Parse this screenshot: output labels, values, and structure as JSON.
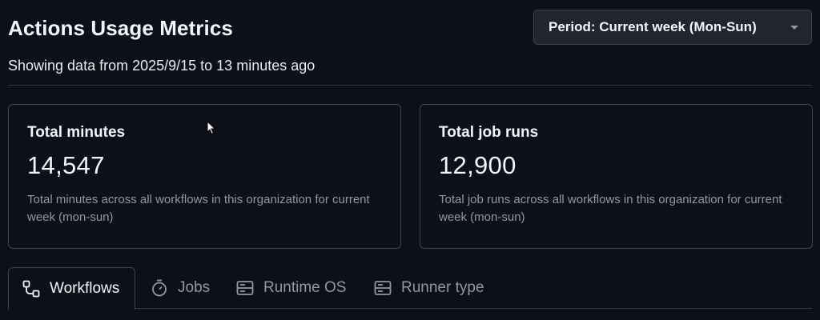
{
  "header": {
    "title": "Actions Usage Metrics",
    "period_button": "Period: Current week (Mon-Sun)"
  },
  "subtitle": "Showing data from 2025/9/15 to 13 minutes ago",
  "cards": [
    {
      "title": "Total minutes",
      "value": "14,547",
      "description": "Total minutes across all workflows in this organization for current week (mon-sun)"
    },
    {
      "title": "Total job runs",
      "value": "12,900",
      "description": "Total job runs across all workflows in this organization for current week (mon-sun)"
    }
  ],
  "tabs": [
    {
      "label": "Workflows",
      "icon": "workflow-icon",
      "active": true
    },
    {
      "label": "Jobs",
      "icon": "stopwatch-icon",
      "active": false
    },
    {
      "label": "Runtime OS",
      "icon": "server-icon",
      "active": false
    },
    {
      "label": "Runner type",
      "icon": "server-icon",
      "active": false
    }
  ],
  "colors": {
    "background": "#0d1117",
    "border": "#3d444d",
    "text_primary": "#f0f6fc",
    "text_muted": "#9198a1"
  }
}
